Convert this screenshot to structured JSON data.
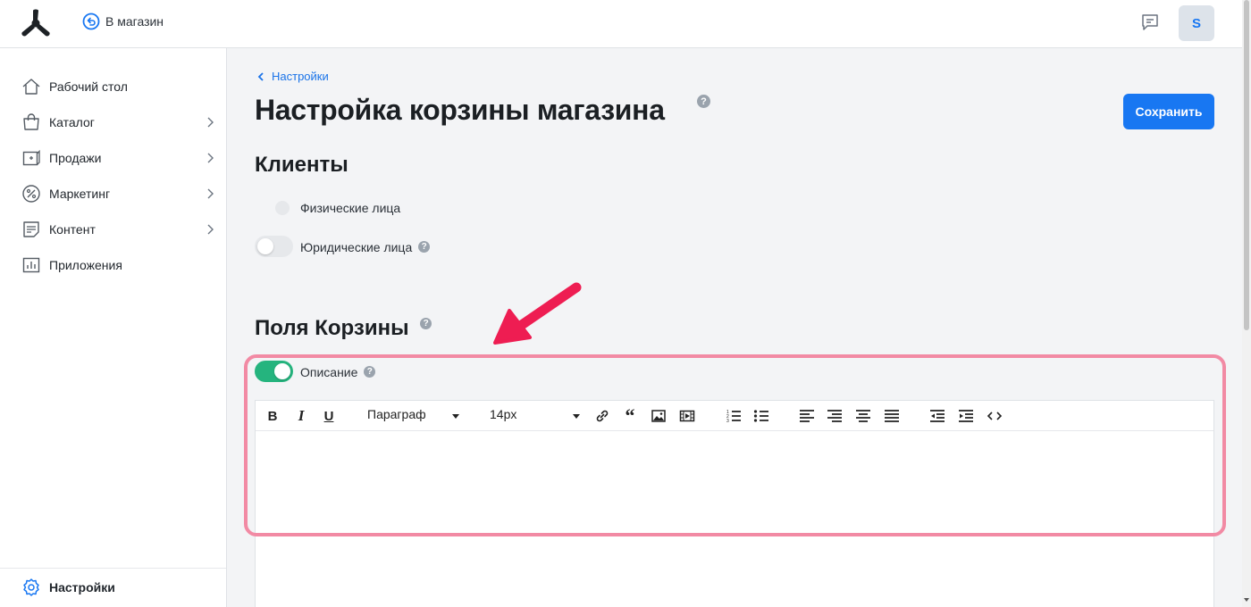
{
  "header": {
    "store_link_label": "В магазин",
    "avatar_letter": "S"
  },
  "sidebar": {
    "items": [
      {
        "label": "Рабочий стол",
        "icon": "home-icon",
        "has_children": false
      },
      {
        "label": "Каталог",
        "icon": "bag-icon",
        "has_children": true
      },
      {
        "label": "Продажи",
        "icon": "sales-icon",
        "has_children": true
      },
      {
        "label": "Маркетинг",
        "icon": "percent-icon",
        "has_children": true
      },
      {
        "label": "Контент",
        "icon": "document-icon",
        "has_children": true
      },
      {
        "label": "Приложения",
        "icon": "chart-icon",
        "has_children": false
      }
    ],
    "settings_label": "Настройки"
  },
  "main": {
    "breadcrumb": "Настройки",
    "title": "Настройка корзины магазина",
    "save_label": "Сохранить",
    "clients": {
      "title": "Клиенты",
      "individuals_label": "Физические лица",
      "legal_label": "Юридические лица",
      "legal_enabled": false
    },
    "cart_fields": {
      "title": "Поля Корзины",
      "description_label": "Описание",
      "description_enabled": true
    },
    "editor": {
      "paragraph_label": "Параграф",
      "font_size_label": "14px"
    }
  },
  "colors": {
    "accent": "#1877f2",
    "toggle_on": "#25b47e",
    "highlight": "#f28aa4",
    "arrow": "#ee1d52"
  }
}
